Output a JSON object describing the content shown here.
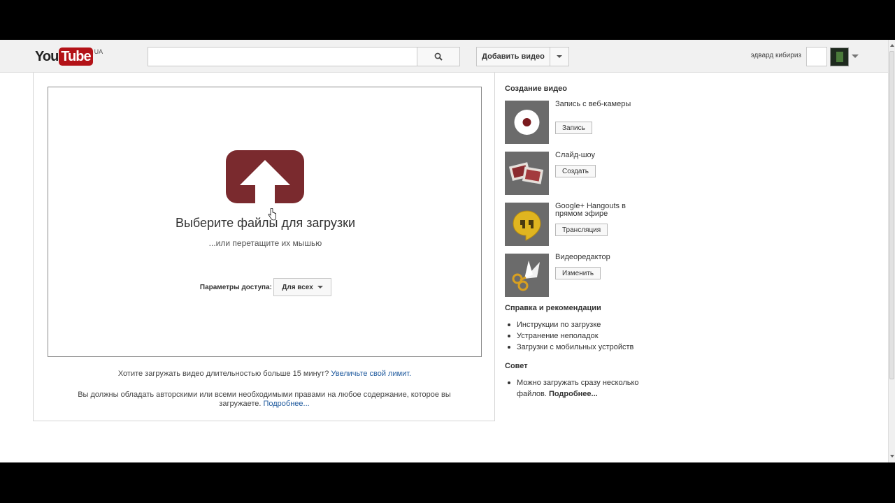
{
  "header": {
    "logo_you": "You",
    "logo_tube": "Tube",
    "logo_region": "UA",
    "search_value": "",
    "upload_label": "Добавить видео",
    "username": "эдвард кибириз"
  },
  "upload": {
    "title": "Выберите файлы для загрузки",
    "subtitle": "...или перетащите их мышью",
    "privacy_label": "Параметры доступа:",
    "privacy_value": "Для всех",
    "limit_text": "Хотите загружать видео длительностью больше 15 минут?",
    "limit_link": "Увеличьте свой лимит.",
    "rights_text": "Вы должны обладать авторскими или всеми необходимыми правами на любое содержание, которое вы загружаете.",
    "rights_link": "Подробнее..."
  },
  "sidebar": {
    "create_heading": "Создание видео",
    "tools": [
      {
        "icon": "webcam-record-icon",
        "label": "Запись с веб-камеры",
        "button": "Запись"
      },
      {
        "icon": "slideshow-icon",
        "label": "Слайд-шоу",
        "button": "Создать"
      },
      {
        "icon": "hangouts-icon",
        "label": "Google+ Hangouts в прямом эфире",
        "button": "Трансляция"
      },
      {
        "icon": "scissors-icon",
        "label": "Видеоредактор",
        "button": "Изменить"
      }
    ],
    "help_heading": "Справка и рекомендации",
    "help_links": [
      "Инструкции по загрузке",
      "Устранение неполадок",
      "Загрузки с мобильных устройств"
    ],
    "tip_heading": "Совет",
    "tip_text": "Можно загружать сразу несколько файлов.",
    "tip_link": "Подробнее..."
  },
  "colors": {
    "brand_red": "#b31217",
    "upload_icon": "#7a2a2e",
    "link": "#1f5a9e"
  }
}
